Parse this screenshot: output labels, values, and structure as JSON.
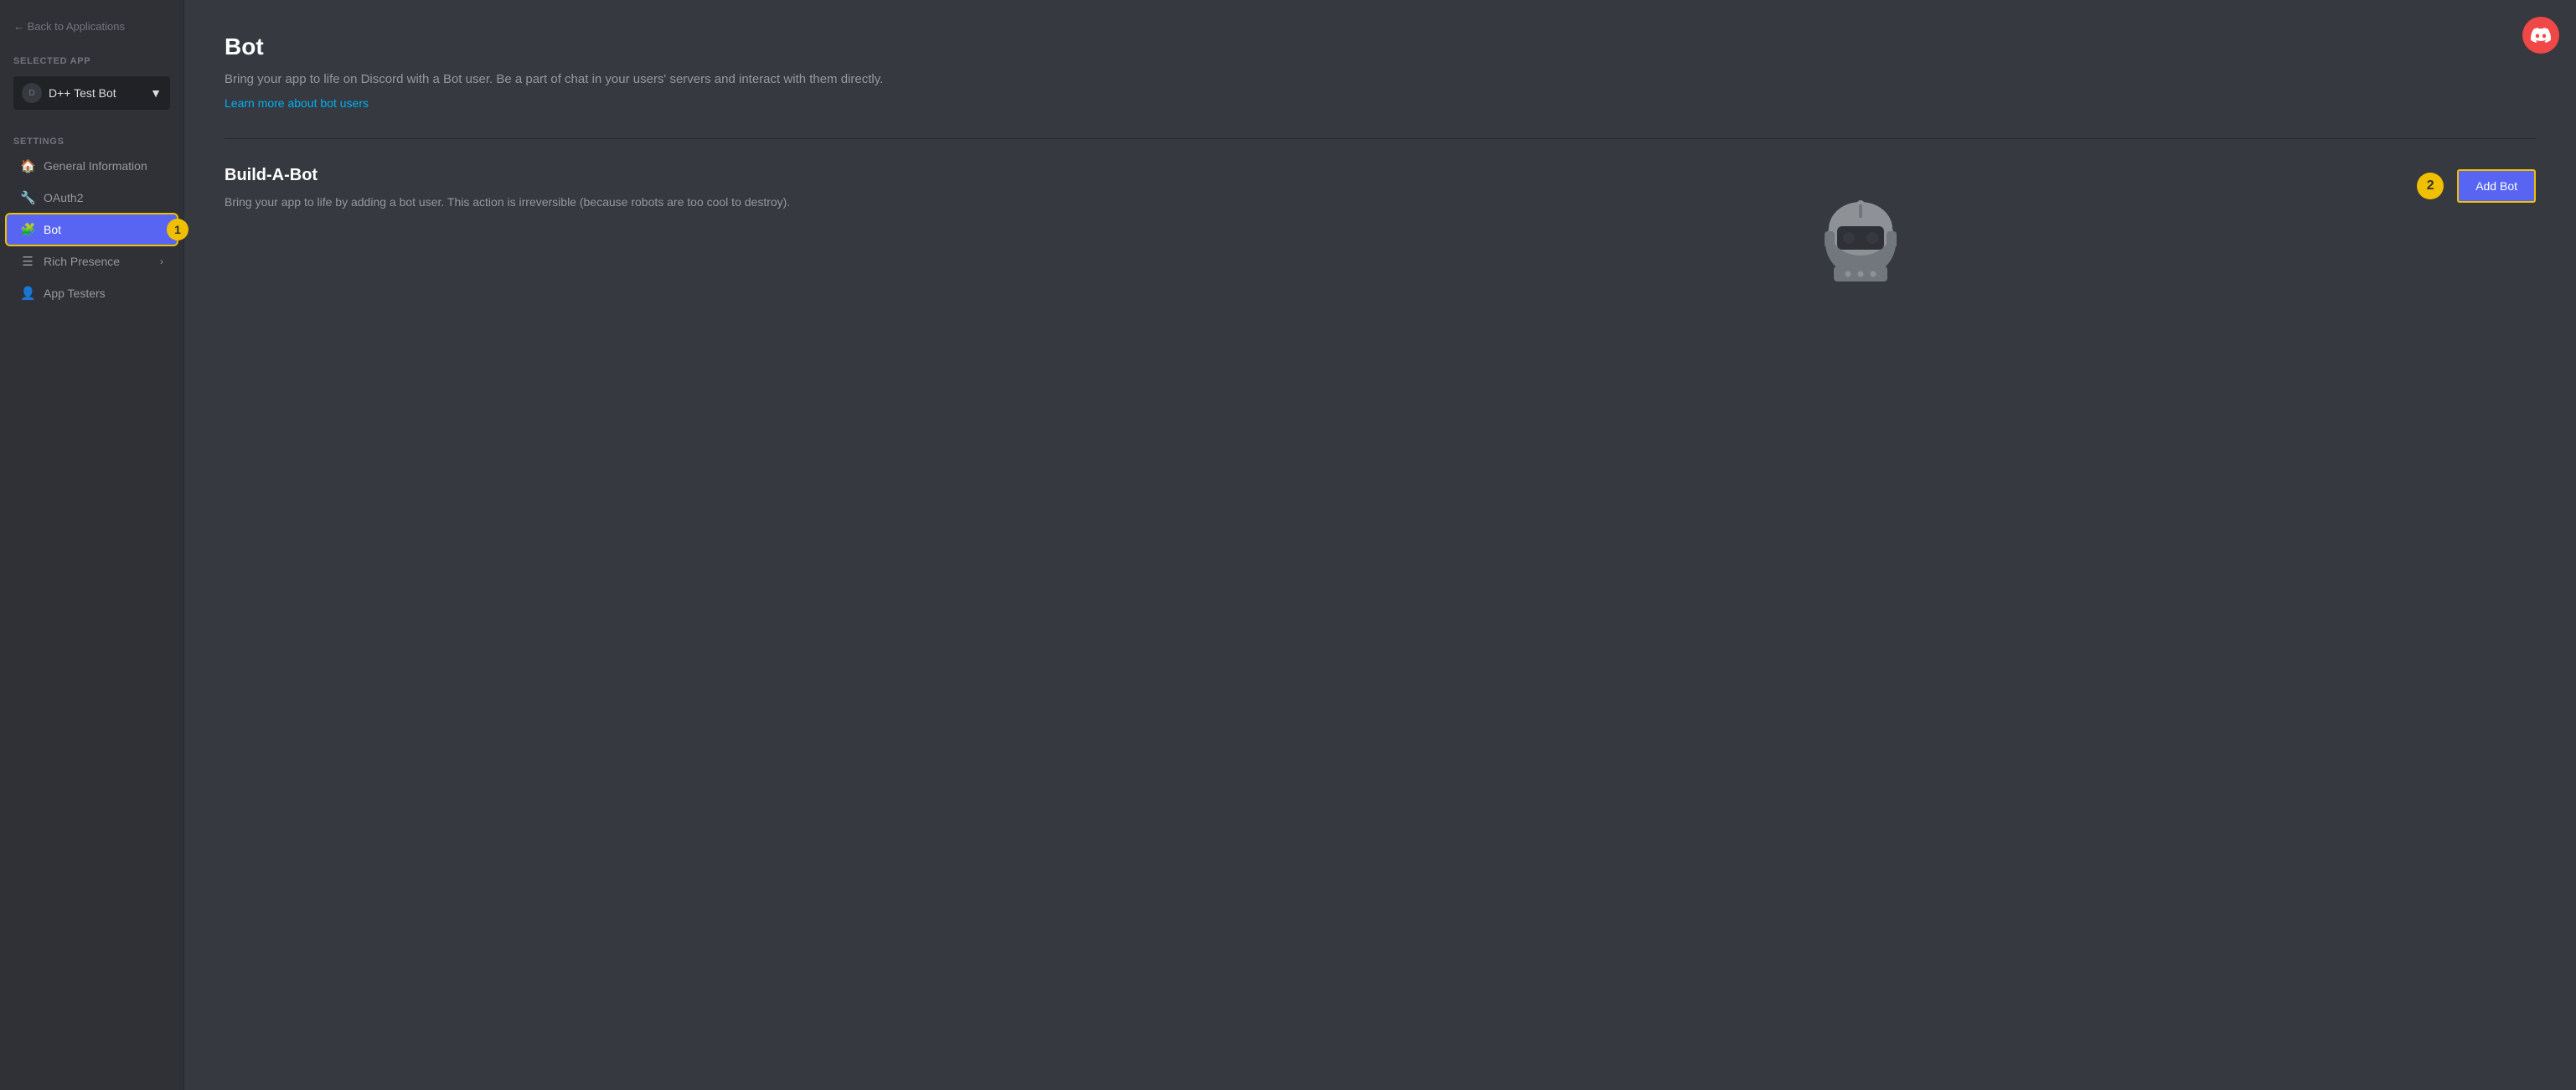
{
  "sidebar": {
    "back_label": "← Back to Applications",
    "selected_app_label": "SELECTED APP",
    "app_name": "D++ Test Bot",
    "settings_label": "SETTINGS",
    "nav_items": [
      {
        "id": "general-information",
        "label": "General Information",
        "icon": "🏠",
        "active": false
      },
      {
        "id": "oauth2",
        "label": "OAuth2",
        "icon": "🔧",
        "active": false
      },
      {
        "id": "bot",
        "label": "Bot",
        "icon": "🧩",
        "active": true
      },
      {
        "id": "rich-presence",
        "label": "Rich Presence",
        "icon": "☰",
        "active": false,
        "chevron": true
      },
      {
        "id": "app-testers",
        "label": "App Testers",
        "icon": "👤",
        "active": false
      }
    ]
  },
  "main": {
    "title": "Bot",
    "description": "Bring your app to life on Discord with a Bot user. Be a part of chat in your users' servers and interact with them directly.",
    "learn_more": "Learn more about bot users",
    "build_a_bot": {
      "title": "Build-A-Bot",
      "description": "Bring your app to life by adding a bot user. This action is irreversible (because robots are too cool to destroy).",
      "add_bot_label": "Add Bot"
    }
  },
  "badges": {
    "one": "1",
    "two": "2"
  },
  "colors": {
    "active_nav": "#5865f2",
    "badge": "#f0c000",
    "link": "#00b0f4",
    "discord_logo_bg": "#f04747"
  }
}
